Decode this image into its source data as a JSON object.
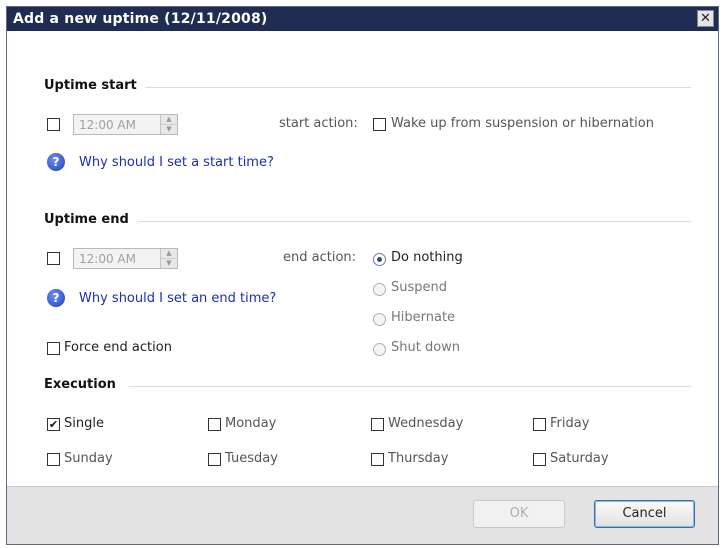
{
  "window": {
    "title": "Add a new uptime (12/11/2008)",
    "close_glyph": "✕"
  },
  "uptime_start": {
    "header": "Uptime start",
    "time_value": "12:00 AM",
    "action_label": "start action:",
    "wake_label": "Wake up from suspension or hibernation",
    "help_link": "Why should I set a start time?",
    "enabled_checked": false,
    "wake_checked": false
  },
  "uptime_end": {
    "header": "Uptime end",
    "time_value": "12:00 AM",
    "action_label": "end action:",
    "help_link": "Why should I set an end time?",
    "force_label": "Force end action",
    "enabled_checked": false,
    "force_checked": false,
    "actions": [
      {
        "label": "Do nothing",
        "selected": true
      },
      {
        "label": "Suspend",
        "selected": false
      },
      {
        "label": "Hibernate",
        "selected": false
      },
      {
        "label": "Shut down",
        "selected": false
      }
    ]
  },
  "execution": {
    "header": "Execution",
    "options": [
      {
        "label": "Single",
        "checked": true
      },
      {
        "label": "Monday",
        "checked": false
      },
      {
        "label": "Wednesday",
        "checked": false
      },
      {
        "label": "Friday",
        "checked": false
      },
      {
        "label": "Sunday",
        "checked": false
      },
      {
        "label": "Tuesday",
        "checked": false
      },
      {
        "label": "Thursday",
        "checked": false
      },
      {
        "label": "Saturday",
        "checked": false
      }
    ]
  },
  "footer": {
    "ok_label": "OK",
    "cancel_label": "Cancel",
    "ok_enabled": false
  },
  "icons": {
    "help": "help-question-icon",
    "checkmark": "✔",
    "spin_up": "▲",
    "spin_down": "▼",
    "help_glyph": "?"
  },
  "colors": {
    "title_bar": "#1f2d53",
    "link": "#1a2fb0",
    "radio_selected": "#2f4f86"
  }
}
